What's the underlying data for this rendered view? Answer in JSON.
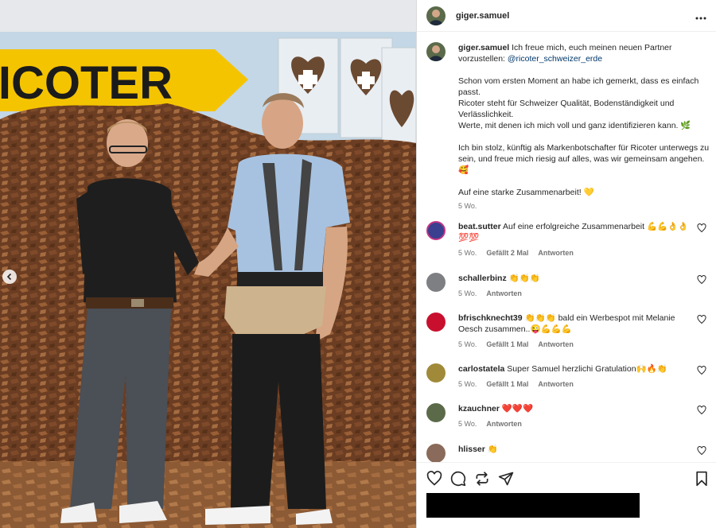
{
  "post": {
    "username": "giger.samuel",
    "more_icon": "more-horizontal-icon",
    "sign_text": "RICOTER",
    "caption": {
      "username": "giger.samuel",
      "line1": "Ich freue mich, euch meinen neuen Partner vorzustellen:",
      "mention": "@ricoter_schweizer_erde",
      "p2": "Schon vom ersten Moment an habe ich gemerkt, dass es einfach passt.",
      "p3": "Ricoter steht für Schweizer Qualität, Bodenständigkeit und Verlässlichkeit.",
      "p4": "Werte, mit denen ich mich voll und ganz identifizieren kann. 🌿",
      "p5": "Ich bin stolz, künftig als Markenbotschafter für Ricoter unterwegs zu sein, und freue mich riesig auf alles, was wir gemeinsam angehen. 🥰",
      "p6": "Auf eine starke Zusammenarbeit! 💛",
      "time": "5 Wo."
    }
  },
  "comments": [
    {
      "user": "beat.sutter",
      "text": "Auf eine erfolgreiche Zusammenarbeit 💪💪👌👌💯💯",
      "time": "5 Wo.",
      "likes": "Gefällt 2 Mal",
      "reply": "Antworten",
      "avatar_color": "#3a3f8f"
    },
    {
      "user": "schallerbinz",
      "text": "👏👏👏",
      "time": "5 Wo.",
      "likes": "",
      "reply": "Antworten",
      "avatar_color": "#7d7f82"
    },
    {
      "user": "bfrischknecht39",
      "text": "👏👏👏 bald ein Werbespot mit Melanie Oesch zusammen..😜💪💪💪",
      "time": "5 Wo.",
      "likes": "Gefällt 1 Mal",
      "reply": "Antworten",
      "avatar_color": "#c8102e"
    },
    {
      "user": "carlostatela",
      "text": "Super Samuel herzlichi Gratulation🙌🔥👏",
      "time": "5 Wo.",
      "likes": "Gefällt 1 Mal",
      "reply": "Antworten",
      "avatar_color": "#a08a3a"
    },
    {
      "user": "kzauchner",
      "text": "❤️❤️❤️",
      "time": "5 Wo.",
      "likes": "",
      "reply": "Antworten",
      "avatar_color": "#5b6b4a"
    },
    {
      "user": "hlisser",
      "text": "👏",
      "time": "",
      "likes": "",
      "reply": "",
      "avatar_color": "#8a6a5a"
    }
  ],
  "icons": {
    "like": "heart-icon",
    "comment": "comment-icon",
    "repost": "repost-icon",
    "share": "send-icon",
    "save": "bookmark-icon",
    "carousel_prev": "chevron-left-icon"
  },
  "colors": {
    "text": "#262626",
    "secondary": "#737373",
    "link": "#00376b",
    "border": "#dbdbdb",
    "sign_yellow": "#f5c400"
  }
}
